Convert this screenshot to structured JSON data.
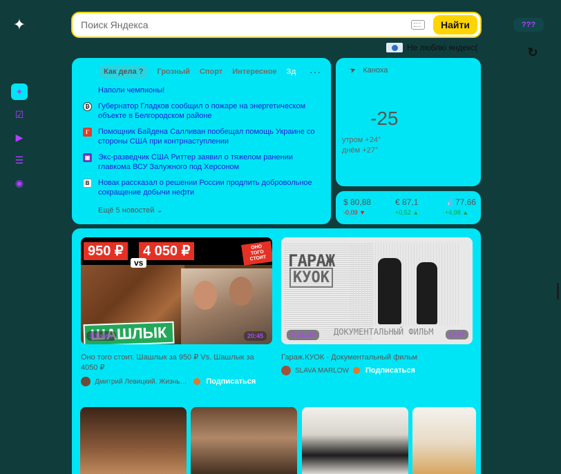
{
  "search": {
    "placeholder": "Поиск Яндекса",
    "button_label": "Найти"
  },
  "profile_label": "???",
  "dislike_text": "Не люблю яндекс(",
  "news": {
    "tabs": [
      {
        "label": "Как дела ?"
      },
      {
        "label": "Грозный"
      },
      {
        "label": "Спорт"
      },
      {
        "label": "Интересное"
      },
      {
        "label": "Зд"
      }
    ],
    "items": [
      {
        "text": "Наполи чемпионы!",
        "icon": "none"
      },
      {
        "text": "Губернатор Гладков сообщил о пожаре на энергетическом объекте в Белгородском районе",
        "icon": "coin-icon"
      },
      {
        "text": "Помощник Байдена Салливан пообещал помощь Украине со стороны США при контрнаступлении",
        "icon": "gazeta-icon",
        "glyph": "Г"
      },
      {
        "text": "Экс-разведчик США Риттер заявил о тяжелом ранении главкома ВСУ Залужного под Херсоном",
        "icon": "purple-square-icon"
      },
      {
        "text": "Новак рассказал о решении России продлить добровольное сокращение добычи нефти",
        "icon": "vedomosti-icon",
        "glyph": "В"
      }
    ],
    "more_label": "Ещё 5 новостей"
  },
  "weather": {
    "location": "Каноха",
    "temperature": "-25",
    "morning": "утром +24°",
    "day": "днём +27°"
  },
  "rates": [
    {
      "value": "$ 80,88",
      "delta": "-0,09",
      "trend": "down"
    },
    {
      "value": "€ 87,1",
      "delta": "+0,52",
      "trend": "up"
    },
    {
      "value": "77,66",
      "delta": "+4,98",
      "trend": "up"
    }
  ],
  "videos": [
    {
      "title": "Оно того стоит. Шашлык за 950 ₽ Vs. Шашлык за 4050 ₽",
      "author": "Дмитрий Левицкий. Жизнь…",
      "subscribe": "Подписаться",
      "views": "3,1 млн",
      "duration": "20:45",
      "thumb_price_1": "950 ₽",
      "thumb_price_2": "4 050 ₽",
      "thumb_vs": "vs",
      "thumb_sticker": "ОНО ТОГО СТОИТ",
      "thumb_caption": "ШАШЛЫК"
    },
    {
      "title": "Гараж.КУОК - Документальный фильм",
      "author": "SLAVA MARLOW",
      "subscribe": "Подписаться",
      "views": "231,5к",
      "duration": "17:07",
      "thumb_title": "ГАРАЖ",
      "thumb_subtitle": "КУОК",
      "thumb_caption": "ДОКУМЕНТАЛЬНЫЙ ФИЛЬМ"
    }
  ],
  "colors": {
    "page_bg": "#103c3c",
    "card_bg": "#00e5f5",
    "accent_yellow": "#ffd400",
    "link_blue": "#2121d6",
    "accent_purple": "#b042ff"
  }
}
